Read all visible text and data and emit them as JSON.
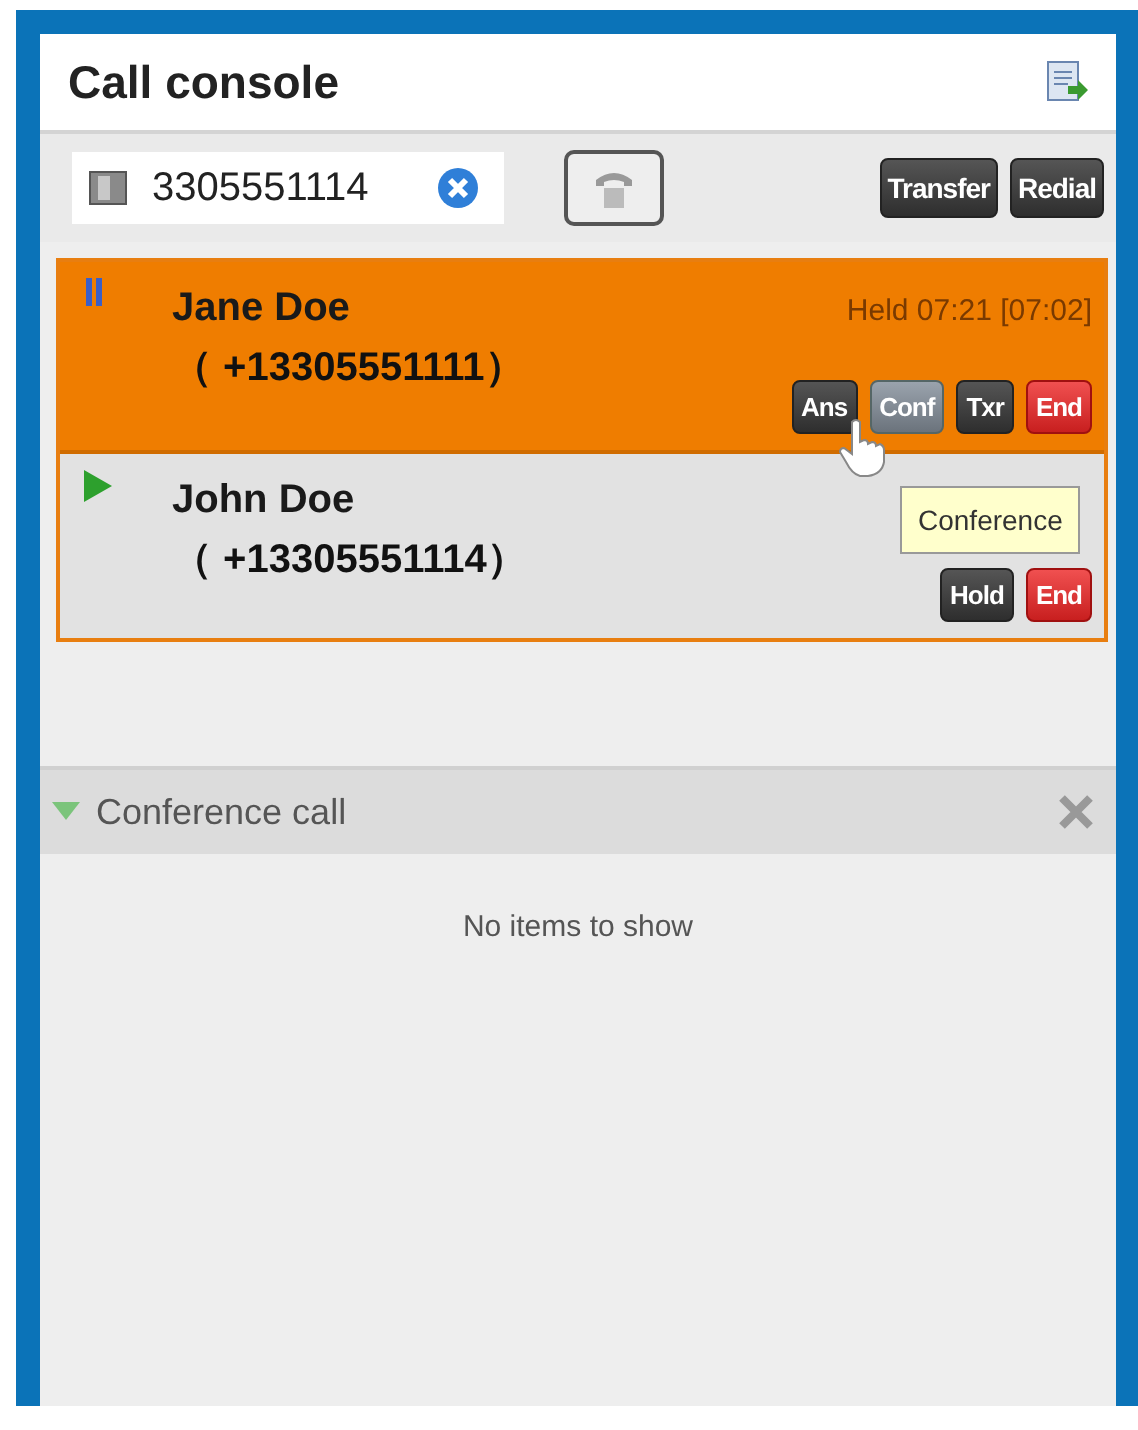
{
  "window": {
    "title": "Call console"
  },
  "dial": {
    "value": "3305551114"
  },
  "toolbar_buttons": [
    "Transfer",
    "Redial"
  ],
  "calls": [
    {
      "name": "Jane Doe",
      "number": "（ +13305551111）",
      "kind": "held",
      "selected": true,
      "timer": "Held 07:21 [07:02]",
      "buttons": [
        {
          "label": "Ans",
          "kind": "dark",
          "hovered": false
        },
        {
          "label": "Conf",
          "kind": "dark",
          "hovered": true
        },
        {
          "label": "Txr",
          "kind": "dark",
          "hovered": false
        },
        {
          "label": "End",
          "kind": "red",
          "hovered": false
        }
      ]
    },
    {
      "name": "John Doe",
      "number": "（ +13305551114）",
      "kind": "active",
      "selected": false,
      "buttons": [
        {
          "label": "Hold",
          "kind": "dark",
          "hovered": false
        },
        {
          "label": "End",
          "kind": "red",
          "hovered": false
        }
      ]
    }
  ],
  "tooltip": "Conference",
  "conference": {
    "title": "Conference call",
    "expanded": true,
    "empty_text": "No items to show"
  }
}
